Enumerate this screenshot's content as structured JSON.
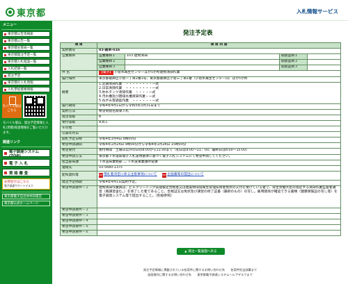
{
  "header": {
    "logo_text": "東京都",
    "system_title": "入札情報サービス"
  },
  "sidebar": {
    "menu_heading": "メニュー",
    "items": [
      "東京都公告等検索",
      "東京都公告一覧",
      "東京都主管局一覧",
      "東京都発注予定一覧",
      "東京都入札経過一覧",
      "入札結果一覧",
      "発注予定",
      "東京都の入札情報",
      "入札参加資格情報"
    ],
    "mobile_label": "モバイル版はこちら",
    "mobile_note": "モバイル版は、発注予定情報と入札(見積)経過情報をご覧いただけます。",
    "links_heading": "関連リンク",
    "big_links": [
      "電子調達システム(TOP)",
      "電 子 入 札",
      "資 格 審 査"
    ],
    "help_title": "お問合せはこちら",
    "help_tagline": "電子調達サポートデスク",
    "bottom_links": [
      "東京都電子自治体共同運営",
      "東京都公式ホームページ"
    ]
  },
  "main": {
    "page_title": "発注予定表",
    "table_header": {
      "left": "項 目",
      "right": "項 目 内 容"
    },
    "contract_no": {
      "label": "契約番号",
      "value": "03-雑草-016"
    },
    "business_type": {
      "label": "営業種目",
      "rows": [
        {
          "name": "営業種目１",
          "value": "103 建物清掃",
          "rank_label": "取扱品目１"
        },
        {
          "name": "営業種目２",
          "value": "",
          "rank_label": "取扱品目２"
        },
        {
          "name": "営業種目３",
          "value": "",
          "rank_label": "取扱品目３"
        }
      ]
    },
    "subject": {
      "label": "件 名",
      "tag": "【電子】",
      "value": "小管水再生センターほか5か所建物清掃作業"
    },
    "location": {
      "label": "履行場所",
      "value": "東京都葛飾区小菅一丁目2番1号、東京都葛飾区小菅三丁目1番（小菅水再生センター内）ほか5か所"
    },
    "summary": {
      "label": "概要",
      "lines": [
        "1.定期清掃作業　・・・・・・・・一式",
        "2.日常清掃作業　・・・・・・・・一式",
        "3.貯水タンク清掃作業　・・・・一式",
        "4.汚水槽及び雑排水槽清掃作業・一式",
        "5.ねずみ等調査作業　・・・・・・一式"
      ]
    },
    "period": {
      "label": "履行期間",
      "value": "令和4年4月1日から令和5年3月31日まで"
    },
    "contract_method": {
      "label": "契約方法",
      "value": "希望制指名競争入札"
    },
    "order_grade": {
      "label": "発注等級",
      "value": "B"
    },
    "accept_grade": {
      "label": "受付等級",
      "value": "A,B,C"
    },
    "other": {
      "label": "その他",
      "value": ""
    },
    "notice_date": {
      "label": "公表年月日",
      "value": ""
    },
    "reserve_date": {
      "label": "開札予定日時",
      "value": "令和4年3月4日 9時00分"
    },
    "apply_period": {
      "label": "希望申請期間",
      "value": "令和4年1月24日 9時00分から令和4年1月28日 15時00分"
    },
    "apply_time": {
      "label": "希望受付",
      "value": "受付時間　土曜日以外の日の8:00から21:00まで（初日は9:00〜21：00、最終日は8:00〜15:00）"
    },
    "apply_method": {
      "label": "希望申請方法",
      "value": "東京都下水道局電子入札運用基準に基づく電子入札システムにて希望申請してください。"
    },
    "department": {
      "label": "担当部局課",
      "value": "下水道局業務部 二 下水道事業課所管課"
    },
    "contact": {
      "label": "連絡先",
      "value": "03-5680-1375"
    },
    "docs": {
      "label": "配布資料等",
      "file1": "落札者決定に係る注意事項について",
      "file2": "企画書等の提出について"
    },
    "planned_date": {
      "label": "発注予定時期",
      "value": "令和4年4月1日契約予定。"
    },
    "req1": {
      "label": "希望申請要件－１",
      "value": "建物清掃作業員は、ビルクリーニング技能検定合格者又は建築物環境衛生管理技術者免状の交付を受けている者で、厚生労働大臣の指定する清掃作業監督者講習（再講習含む。）を修了した者であること。合格証又は免状及び講習の修了証書（最新のもの）の写し。雇用関係が確認できる書類（健康保険証の写し等）を電子調達システム等で提出すること。（別紙参照）"
    },
    "req_labels": [
      "希望申請要件－２",
      "希望申請要件－３",
      "希望申請要件－４",
      "希望申請要件－５",
      "希望申請要件－６"
    ],
    "return_button": "発注一覧画面へ戻る"
  },
  "footer": {
    "line1": "発注予定情報に掲載されている各案件に関するお問い合わせ先　　各案件担当部署まで",
    "line2": "画面操作に関するお問い合わせ先　　東京都電子調達システムヘルプデスクまで"
  }
}
